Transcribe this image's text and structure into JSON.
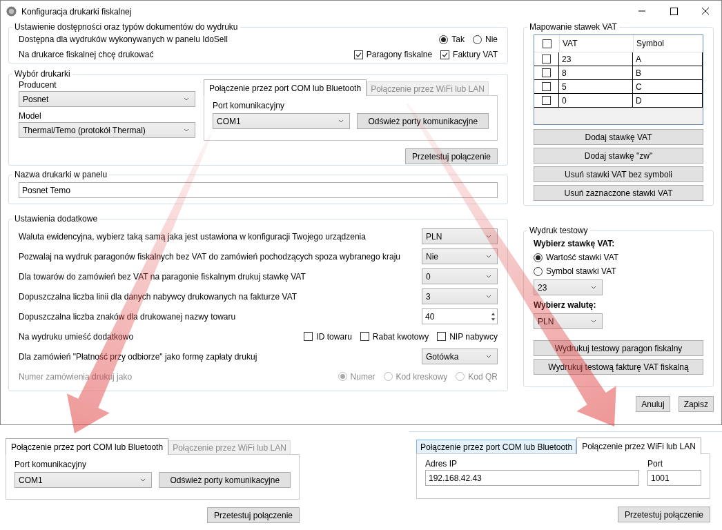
{
  "window": {
    "title": "Konfiguracja drukarki fiskalnej"
  },
  "availability": {
    "legend": "Ustawienie dostępności oraz typów dokumentów do wydruku",
    "available_label": "Dostępna dla wydruków wykonywanych w panelu IdoSell",
    "available_options": [
      {
        "label": "Tak",
        "selected": true
      },
      {
        "label": "Nie",
        "selected": false
      }
    ],
    "print_label": "Na drukarce fiskalnej chcę drukować",
    "print_options": [
      {
        "label": "Paragony fiskalne",
        "checked": true
      },
      {
        "label": "Faktury VAT",
        "checked": true
      }
    ]
  },
  "printer": {
    "legend": "Wybór drukarki",
    "producer_label": "Producent",
    "producer": "Posnet",
    "model_label": "Model",
    "model": "Thermal/Temo (protokół Thermal)",
    "connection": {
      "tabs": [
        {
          "label": "Połączenie przez port COM lub Bluetooth",
          "selected": true,
          "hovered": false
        },
        {
          "label": "Połączenie przez WiFi lub LAN",
          "selected": false,
          "hovered": false
        }
      ],
      "panel": {
        "kind": "com",
        "port_label": "Port komunikacyjny",
        "port": "COM1",
        "refresh_button": "Odśwież porty komunikacyjne"
      },
      "test_button": "Przetestuj połączenie"
    }
  },
  "printer_name": {
    "legend": "Nazwa drukarki w panelu",
    "value": "Posnet Temo"
  },
  "additional": {
    "legend": "Ustawienia dodatkowe",
    "rows": [
      {
        "kind": "select",
        "label": "Waluta ewidencyjna, wybierz taką samą jaka jest ustawiona w konfiguracji Twojego urządzenia",
        "value": "PLN"
      },
      {
        "kind": "select",
        "label": "Pozwalaj na wydruk paragonów fiskalnych bez VAT do zamówień pochodzących spoza wybranego kraju",
        "value": "Nie"
      },
      {
        "kind": "select",
        "label": "Dla towarów do zamówień bez VAT na paragonie fiskalnym drukuj stawkę VAT",
        "value": "0"
      },
      {
        "kind": "select",
        "label": "Dopuszczalna liczba linii dla danych nabywcy drukowanych na fakturze VAT",
        "value": "3"
      },
      {
        "kind": "spin",
        "label": "Dopuszczalna liczba znaków dla drukowanej nazwy towaru",
        "value": "40"
      },
      {
        "kind": "checks",
        "label": "Na wydruku umieść dodatkowo",
        "options": [
          {
            "label": "ID towaru",
            "checked": false
          },
          {
            "label": "Rabat kwotowy",
            "checked": false
          },
          {
            "label": "NIP nabywcy",
            "checked": false
          }
        ]
      },
      {
        "kind": "select",
        "label": "Dla zamówień \"Płatność przy odbiorze\" jako formę zapłaty drukuj",
        "value": "Gotówka"
      },
      {
        "kind": "radios",
        "label": "Numer zamówienia drukuj jako",
        "disabled": true,
        "options": [
          {
            "label": "Numer",
            "selected": true
          },
          {
            "label": "Kod kreskowy",
            "selected": false
          },
          {
            "label": "Kod QR",
            "selected": false
          }
        ]
      }
    ]
  },
  "vat_mapping": {
    "legend": "Mapowanie stawek VAT",
    "all_checked": false,
    "columns": [
      "VAT",
      "Symbol"
    ],
    "rows": [
      {
        "vat": "23",
        "symbol": "A",
        "checked": false
      },
      {
        "vat": "8",
        "symbol": "B",
        "checked": false
      },
      {
        "vat": "5",
        "symbol": "C",
        "checked": false
      },
      {
        "vat": "0",
        "symbol": "D",
        "checked": false
      }
    ],
    "buttons": [
      "Dodaj stawkę VAT",
      "Dodaj stawkę \"zw\"",
      "Usuń stawki VAT bez symboli",
      "Usuń zaznaczone stawki VAT"
    ]
  },
  "test_print": {
    "legend": "Wydruk testowy",
    "rate_heading": "Wybierz stawkę VAT:",
    "rate_options": [
      {
        "label": "Wartość stawki VAT",
        "selected": true
      },
      {
        "label": "Symbol stawki VAT",
        "selected": false
      }
    ],
    "rate": "23",
    "currency_heading": "Wybierz walutę:",
    "currency": "PLN",
    "buttons": [
      "Wydrukuj testowy paragon fiskalny",
      "Wydrukuj testową fakturę VAT fiskalną"
    ]
  },
  "footer_buttons": [
    "Anuluj",
    "Zapisz"
  ],
  "insets": [
    {
      "tabs": [
        {
          "label": "Połączenie przez port COM lub Bluetooth",
          "selected": true,
          "hovered": false
        },
        {
          "label": "Połączenie przez WiFi lub LAN",
          "selected": false,
          "hovered": false
        }
      ],
      "panel": {
        "kind": "com",
        "port_label": "Port komunikacyjny",
        "port": "COM1",
        "refresh_button": "Odśwież porty komunikacyjne"
      },
      "test_button": "Przetestuj połączenie"
    },
    {
      "tabs": [
        {
          "label": "Połączenie przez port COM lub Bluetooth",
          "selected": false,
          "hovered": true
        },
        {
          "label": "Połączenie przez WiFi lub LAN",
          "selected": true,
          "hovered": false
        }
      ],
      "panel": {
        "kind": "wifi",
        "ip_label": "Adres IP",
        "ip": "192.168.42.43",
        "port_label": "Port",
        "port": "1001"
      },
      "test_button": "Przetestuj połączenie"
    }
  ]
}
